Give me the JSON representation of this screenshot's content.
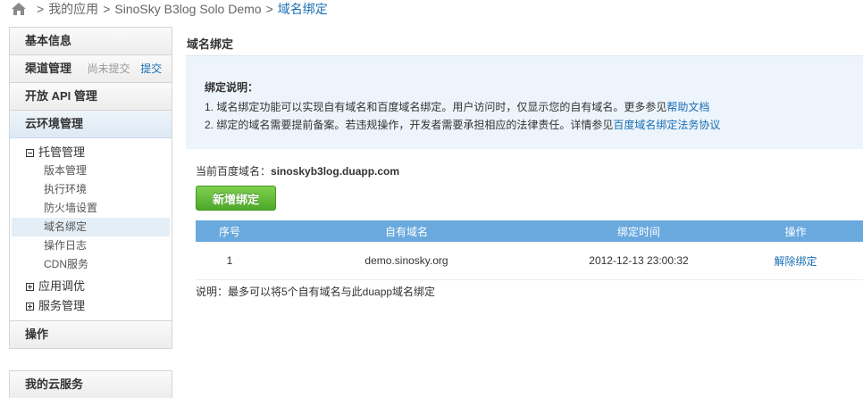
{
  "breadcrumb": {
    "items": [
      "我的应用",
      "SinoSky B3log Solo Demo"
    ],
    "current": "域名绑定",
    "sep": ">"
  },
  "sidebar": {
    "basic": "基本信息",
    "channel": {
      "label": "渠道管理",
      "status": "尚未提交",
      "link": "提交"
    },
    "api": "开放 API 管理",
    "cloud": "云环境管理",
    "hosting": {
      "label": "托管管理",
      "items": [
        "版本管理",
        "执行环境",
        "防火墙设置",
        "域名绑定",
        "操作日志",
        "CDN服务"
      ]
    },
    "tuning": "应用调优",
    "service": "服务管理",
    "ops": "操作",
    "mycloud": "我的云服务"
  },
  "main": {
    "title": "域名绑定",
    "info": {
      "heading": "绑定说明：",
      "line1_text": "1. 域名绑定功能可以实现自有域名和百度域名绑定。用户访问时，仅显示您的自有域名。更多参见",
      "line1_link": "帮助文档",
      "line2_text": "2. 绑定的域名需要提前备案。若违规操作，开发者需要承担相应的法律责任。详情参见",
      "line2_link": "百度域名绑定法务协议"
    },
    "current_label": "当前百度域名：",
    "current_value": "sinoskyb3log.duapp.com",
    "add_button": "新增绑定",
    "table": {
      "headers": [
        "序号",
        "自有域名",
        "绑定时间",
        "操作"
      ],
      "rows": [
        {
          "no": "1",
          "domain": "demo.sinosky.org",
          "time": "2012-12-13 23:00:32",
          "action": "解除绑定"
        }
      ]
    },
    "note": "说明：最多可以将5个自有域名与此duapp域名绑定"
  }
}
